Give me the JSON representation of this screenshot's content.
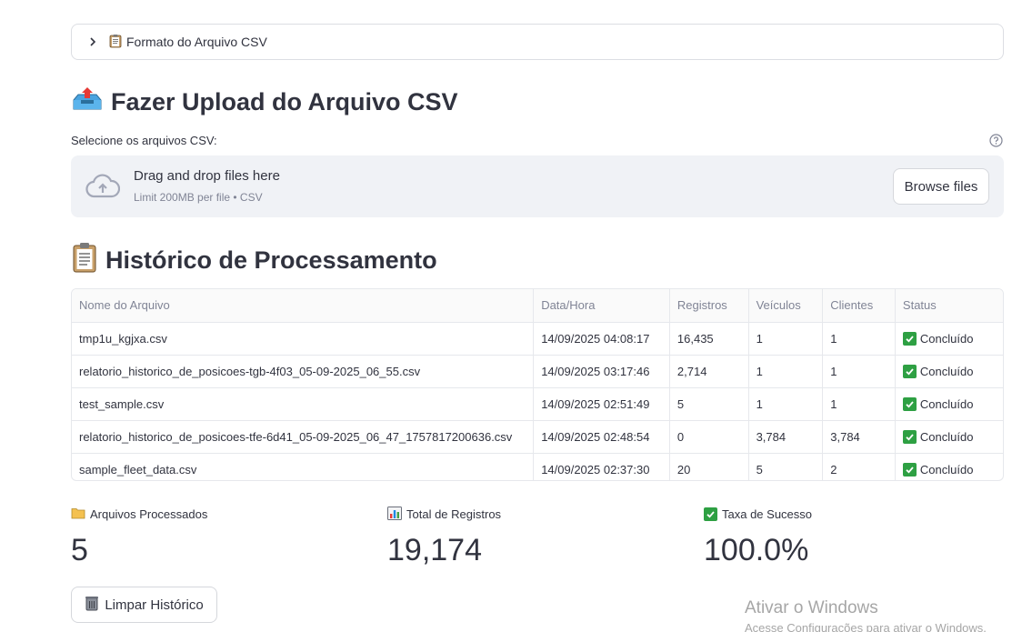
{
  "expander": {
    "label": "Formato do Arquivo CSV",
    "icon": "clipboard-icon"
  },
  "upload": {
    "heading": "Fazer Upload do Arquivo CSV",
    "heading_icon": "outbox-tray-icon",
    "field_label": "Selecione os arquivos CSV:",
    "drop_title": "Drag and drop files here",
    "drop_sub": "Limit 200MB per file • CSV",
    "browse_label": "Browse files"
  },
  "history": {
    "heading": "Histórico de Processamento",
    "heading_icon": "clipboard-icon",
    "columns": [
      "Nome do Arquivo",
      "Data/Hora",
      "Registros",
      "Veículos",
      "Clientes",
      "Status"
    ],
    "rows": [
      [
        "tmp1u_kgjxa.csv",
        "14/09/2025 04:08:17",
        "16,435",
        "1",
        "1",
        "Concluído"
      ],
      [
        "relatorio_historico_de_posicoes-tgb-4f03_05-09-2025_06_55.csv",
        "14/09/2025 03:17:46",
        "2,714",
        "1",
        "1",
        "Concluído"
      ],
      [
        "test_sample.csv",
        "14/09/2025 02:51:49",
        "5",
        "1",
        "1",
        "Concluído"
      ],
      [
        "relatorio_historico_de_posicoes-tfe-6d41_05-09-2025_06_47_1757817200636.csv",
        "14/09/2025 02:48:54",
        "0",
        "3,784",
        "3,784",
        "Concluído"
      ],
      [
        "sample_fleet_data.csv",
        "14/09/2025 02:37:30",
        "20",
        "5",
        "2",
        "Concluído"
      ]
    ]
  },
  "metrics": [
    {
      "label": "Arquivos Processados",
      "value": "5",
      "icon": "folder-icon"
    },
    {
      "label": "Total de Registros",
      "value": "19,174",
      "icon": "bar-chart-icon"
    },
    {
      "label": "Taxa de Sucesso",
      "value": "100.0%",
      "icon": "check-mark-icon"
    }
  ],
  "clear_button": {
    "label": "Limpar Histórico",
    "icon": "trash-icon"
  },
  "watermark": {
    "line1": "Ativar o Windows",
    "line2": "Acesse Configurações para ativar o Windows."
  },
  "colors": {
    "success": "#2ea043",
    "text": "#31333f",
    "muted": "#808495",
    "dropzone_bg": "#f0f2f6"
  }
}
